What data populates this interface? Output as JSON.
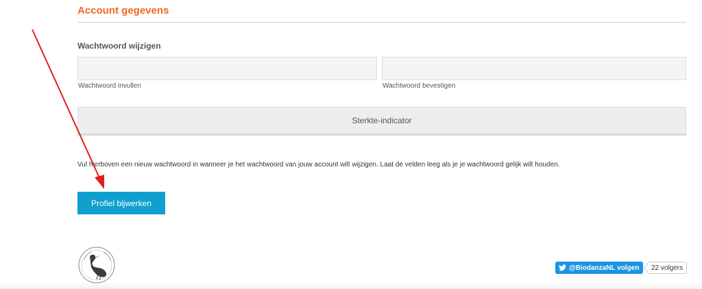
{
  "section": {
    "title": "Account gegevens"
  },
  "password": {
    "subtitle": "Wachtwoord wijzigen",
    "new_label": "Wachtwoord invullen",
    "confirm_label": "Wachtwoord bevestigen",
    "new_value": "",
    "confirm_value": "",
    "strength_text": "Sterkte-indicator",
    "hint": "Vul hierboven een nieuw wachtwoord in wanneer je het wachtwoord van jouw account wilt wijzigen. Laat de velden leeg als je je wachtwoord gelijk wilt houden."
  },
  "actions": {
    "submit_label": "Profiel bijwerken"
  },
  "footer": {
    "twitter_follow_label": "@BiodanzaNL volgen",
    "follower_count": "22 volgers"
  },
  "colors": {
    "accent_orange": "#f26522",
    "button_blue": "#0fa0ce",
    "twitter_blue": "#1b95e0",
    "annotation_red": "#e0201b"
  },
  "icons": {
    "twitter": "twitter-bird-icon",
    "logo": "heron-logo-icon"
  }
}
